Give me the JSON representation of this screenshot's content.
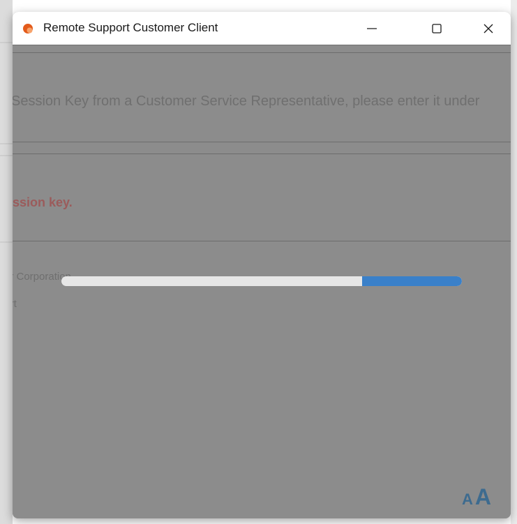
{
  "window": {
    "title": "Remote Support Customer Client",
    "controls": {
      "minimize": "—",
      "maximize": "☐",
      "close": "✕"
    },
    "icon": "orange-drop-icon"
  },
  "content": {
    "instruction": "Session Key from a Customer Service Representative, please enter it under",
    "error": "ession key.",
    "corporation": "ar Corporation",
    "support": "port",
    "progress": {
      "filled_start_fraction": 0.75,
      "filled_end_fraction": 1.0,
      "track_color": "#e6e6e6",
      "fill_color": "#3a80c9"
    },
    "font_size_toggle": {
      "small": "A",
      "large": "A"
    }
  },
  "colors": {
    "overlay": "#8c8c8c",
    "error_text": "#9b5b5b",
    "accent": "#3a80c9",
    "app_icon": "#e35b1b"
  }
}
